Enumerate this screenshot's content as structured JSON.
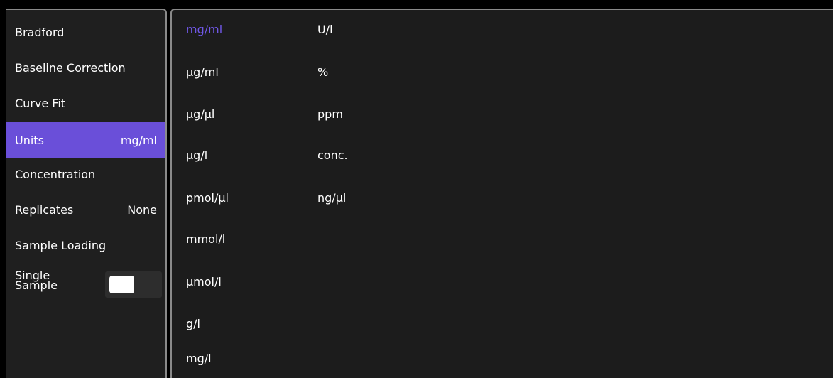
{
  "menu": {
    "bradford": "Bradford",
    "baseline_correction": "Baseline Correction",
    "curve_fit": "Curve Fit",
    "units_label": "Units",
    "units_value": "mg/ml",
    "concentration": "Concentration",
    "replicates_label": "Replicates",
    "replicates_value": "None",
    "sample_loading": "Sample Loading",
    "single_sample_line1": "Single",
    "single_sample_line2": "Sample",
    "single_sample_toggle": "on"
  },
  "units": {
    "col1": [
      "mg/ml",
      "µg/ml",
      "µg/µl",
      "µg/l",
      "pmol/µl",
      "mmol/l",
      "µmol/l",
      "g/l",
      "mg/l"
    ],
    "col2": [
      "U/l",
      "%",
      "ppm",
      "conc.",
      "ng/µl"
    ],
    "selected": "mg/ml"
  },
  "colors": {
    "selected_row": "#6a4fd9",
    "selected_text": "#6f57e6",
    "panel_bg": "#1f1f1f",
    "border": "#8a8a8a"
  }
}
